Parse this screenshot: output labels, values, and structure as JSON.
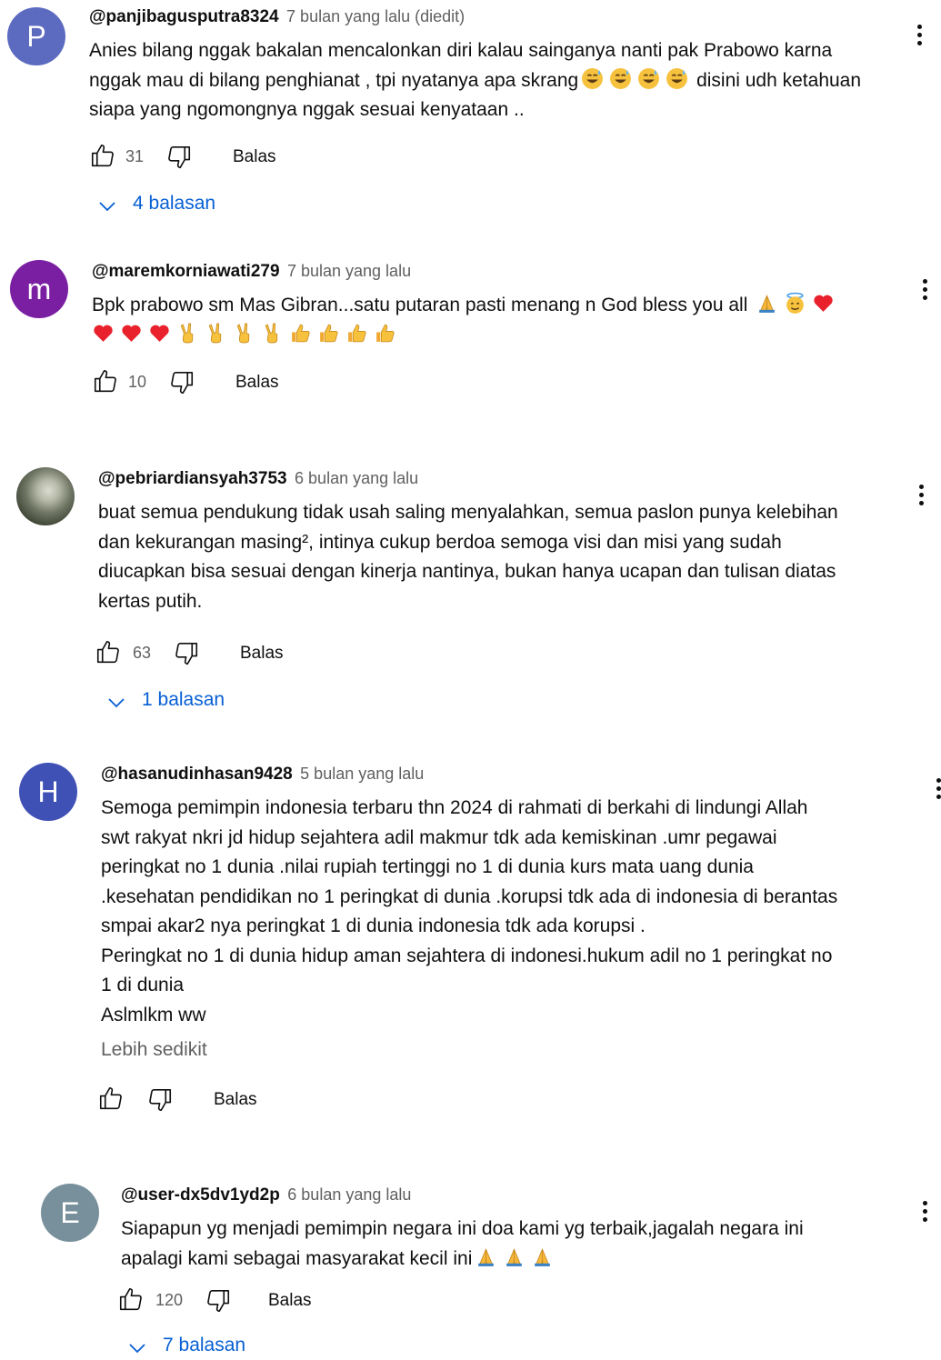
{
  "comments": [
    {
      "avatar_letter": "P",
      "avatar_color": "#5c6bc0",
      "author": "@panjibagusputra8324",
      "time": "7 bulan yang lalu (diedit)",
      "text_before": "Anies bilang nggak bakalan mencalonkan diri kalau sainganya nanti pak Prabowo karna nggak mau di bilang penghianat , tpi nyatanya apa skrang",
      "emoji_mid": [
        "sweat-smile",
        "sweat-smile",
        "sweat-smile",
        "sweat-smile"
      ],
      "text_after": "disini udh ketahuan siapa yang ngomongnya nggak sesuai kenyataan ..",
      "likes": "31",
      "reply_label": "Balas",
      "replies": "4 balasan"
    },
    {
      "avatar_letter": "m",
      "avatar_color": "#7b1fa2",
      "author": "@maremkorniawati279",
      "time": "7 bulan yang lalu",
      "text": "Bpk prabowo sm Mas Gibran...satu putaran pasti menang n God bless you all",
      "emoji_line1": [
        "pray",
        "halo",
        "heart"
      ],
      "emoji_line2": [
        "heart",
        "heart",
        "heart",
        "victory",
        "victory",
        "victory",
        "victory",
        "thumbs-up",
        "thumbs-up",
        "thumbs-up",
        "thumbs-up"
      ],
      "likes": "10",
      "reply_label": "Balas"
    },
    {
      "avatar_photo": true,
      "author": "@pebriardiansyah3753",
      "time": "6 bulan yang lalu",
      "text": "buat semua pendukung tidak usah saling menyalahkan, semua paslon punya kelebihan\ndan kekurangan masing², intinya cukup berdoa semoga visi dan misi yang sudah\ndiucapkan bisa sesuai dengan kinerja nantinya, bukan hanya ucapan dan tulisan diatas\nkertas putih.",
      "likes": "63",
      "reply_label": "Balas",
      "replies": "1 balasan"
    },
    {
      "avatar_letter": "H",
      "avatar_color": "#3f51b5",
      "author": "@hasanudinhasan9428",
      "time": "5 bulan yang lalu",
      "text": "Semoga pemimpin indonesia terbaru thn 2024 di rahmati di berkahi di lindungi Allah\nswt rakyat nkri jd hidup sejahtera adil makmur tdk ada kemiskinan .umr  pegawai\nperingkat no 1 dunia .nilai rupiah tertinggi no 1 di dunia kurs mata uang dunia\n.kesehatan pendidikan no 1 peringkat di dunia .korupsi tdk ada di indonesia di berantas\nsmpai akar2 nya peringkat 1 di dunia indonesia tdk ada korupsi .\nPeringkat no 1 di dunia hidup aman sejahtera di indonesi.hukum adil no 1 peringkat no\n1 di dunia\nAslmlkm ww",
      "show_less": "Lebih sedikit",
      "likes": "",
      "reply_label": "Balas"
    },
    {
      "avatar_letter": "E",
      "avatar_color": "#78909c",
      "author": "@user-dx5dv1yd2p",
      "time": "6 bulan yang lalu",
      "text_line1": "Siapapun yg menjadi pemimpin negara ini doa kami  yg terbaik,jagalah negara ini",
      "text_line2": "apalagi kami sebagai masyarakat kecil ini",
      "emoji_end": [
        "pray",
        "pray",
        "pray"
      ],
      "likes": "120",
      "reply_label": "Balas",
      "replies": "7 balasan"
    }
  ],
  "colors": {
    "link_blue": "#065fd4",
    "secondary_text": "#606060",
    "primary_text": "#0f0f0f"
  },
  "icons": [
    "thumbs-up-icon",
    "thumbs-down-icon",
    "chevron-down-icon",
    "more-vert-icon"
  ]
}
